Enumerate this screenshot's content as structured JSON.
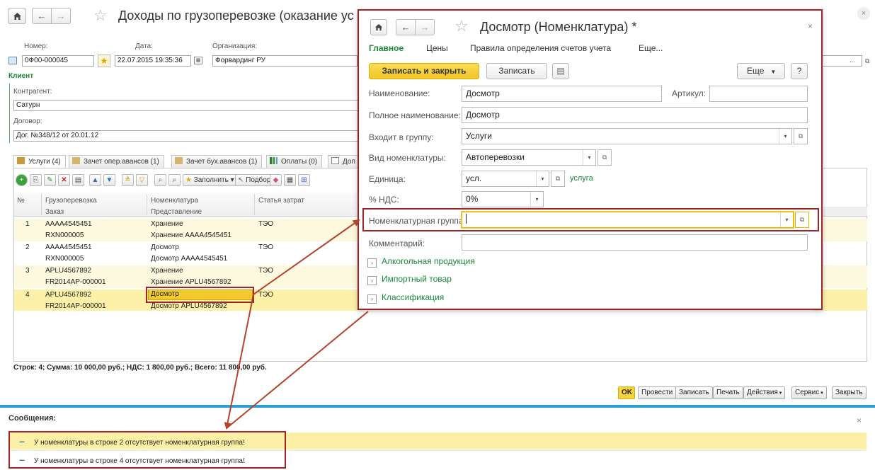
{
  "main_form": {
    "title": "Доходы по грузоперевозке (оказание ус",
    "number_label": "Номер:",
    "number_value": "0Ф00-000045",
    "date_label": "Дата:",
    "date_value": "22.07.2015 19:35:36",
    "org_label": "Организация:",
    "org_value": "Форвардинг РУ",
    "client_section": "Клиент",
    "contractor_label": "Контрагент:",
    "contractor_value": "Сатурн",
    "contract_label": "Договор:",
    "contract_value": "Дог. №348/12 от 20.01.12",
    "tabs": [
      {
        "label": "Услуги (4)",
        "icon": "services-icon"
      },
      {
        "label": "Зачет опер.авансов (1)",
        "icon": "advance-icon"
      },
      {
        "label": "Зачет бух.авансов (1)",
        "icon": "advance-icon"
      },
      {
        "label": "Оплаты (0)",
        "icon": "chart-icon"
      },
      {
        "label": "Доп",
        "icon": "doc-icon"
      }
    ],
    "toolbar": {
      "fill_label": "Заполнить",
      "select_label": "Подбор"
    },
    "grid": {
      "columns_row1": [
        "№",
        "Грузоперевозка",
        "Номенклатура",
        "Статья затрат"
      ],
      "columns_row2": [
        "",
        "Заказ",
        "Представление",
        ""
      ],
      "rows": [
        {
          "n": "1",
          "transport": "АААА4545451",
          "order": "RXN000005",
          "nomenclature": "Хранение",
          "presentation": "Хранение АААА4545451",
          "cost": "ТЭО"
        },
        {
          "n": "2",
          "transport": "АААА4545451",
          "order": "RXN000005",
          "nomenclature": "Досмотр",
          "presentation": "Досмотр АААА4545451",
          "cost": "ТЭО"
        },
        {
          "n": "3",
          "transport": "APLU4567892",
          "order": "FR2014AP-000001",
          "nomenclature": "Хранение",
          "presentation": "Хранение APLU4567892",
          "cost": "ТЭО"
        },
        {
          "n": "4",
          "transport": "APLU4567892",
          "order": "FR2014AP-000001",
          "nomenclature": "Досмотр",
          "presentation": "Досмотр APLU4567892",
          "cost": "ТЭО"
        }
      ]
    },
    "summary": "Строк: 4;  Сумма: 10 000,00 руб.;  НДС: 1 800,00 руб.;  Всего: 11 800,00 руб.",
    "bottom_buttons": {
      "ok": "OK",
      "post": "Провести",
      "save": "Записать",
      "print": "Печать",
      "actions": "Действия",
      "service": "Сервис",
      "close": "Закрыть"
    }
  },
  "messages": {
    "title": "Сообщения:",
    "items": [
      "У номенклатуры в строке 2 отсутствует номенклатурная группа!",
      "У номенклатуры в строке 4 отсутствует номенклатурная группа!"
    ]
  },
  "popup": {
    "title": "Досмотр (Номенклатура) *",
    "tabs": [
      "Главное",
      "Цены",
      "Правила определения счетов учета",
      "Еще..."
    ],
    "btn_save_close": "Записать и закрыть",
    "btn_save": "Записать",
    "btn_more": "Еще",
    "btn_help": "?",
    "name_label": "Наименование:",
    "name_value": "Досмотр",
    "article_label": "Артикул:",
    "article_value": "",
    "fullname_label": "Полное наименование:",
    "fullname_value": "Досмотр",
    "group_label": "Входит в группу:",
    "group_value": "Услуги",
    "kind_label": "Вид номенклатуры:",
    "kind_value": "Автоперевозки",
    "unit_label": "Единица:",
    "unit_value": "усл.",
    "unit_link": "услуга",
    "vat_label": "% НДС:",
    "vat_value": "0%",
    "nomgroup_label": "Номенклатурная группа:",
    "nomgroup_value": "",
    "comment_label": "Комментарий:",
    "comment_value": "",
    "expanders": [
      "Алкогольная продукция",
      "Импортный товар",
      "Классификация"
    ]
  },
  "colors": {
    "highlight_red": "#a3232b",
    "selected_row": "#fdf0a8",
    "accent_green": "#1a8a3a",
    "primary_yellow": "#f6d23b"
  }
}
